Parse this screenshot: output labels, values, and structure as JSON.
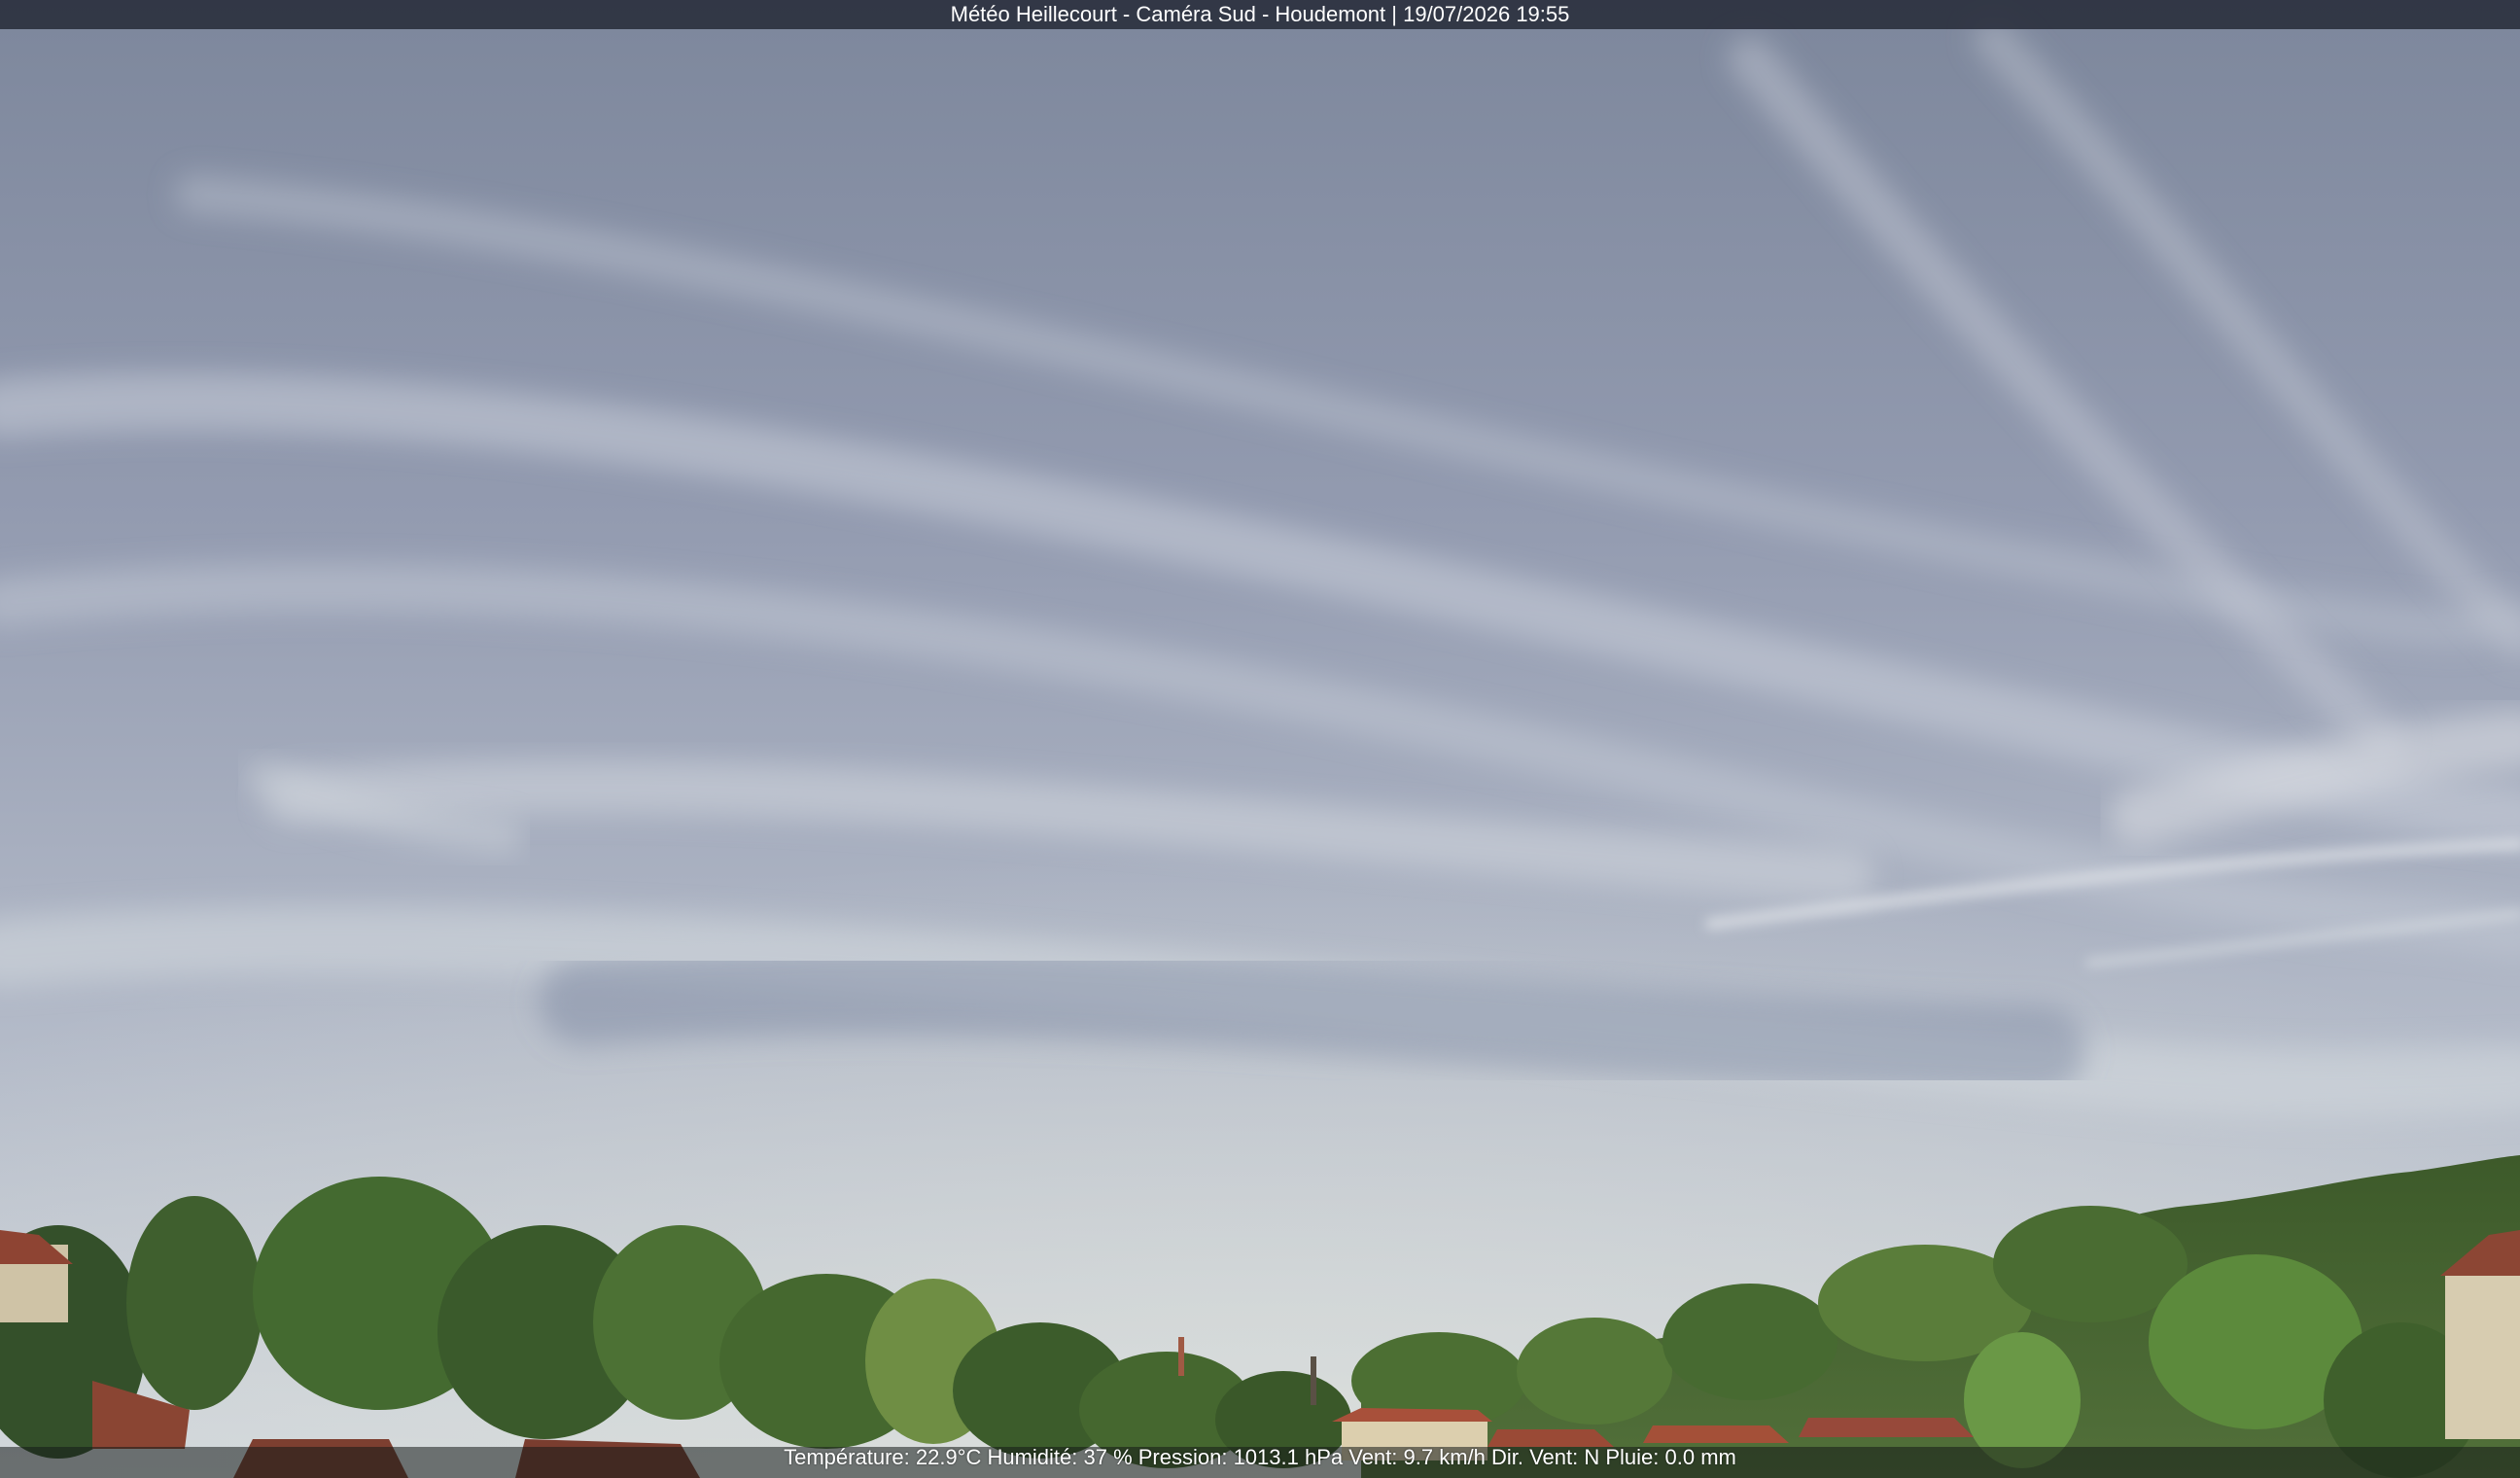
{
  "overlay": {
    "title": "Météo Heillecourt - Caméra Sud - Houdemont | 19/07/2026 19:55",
    "readout": "Température: 22.9°C  Humidité: 37 % Pression: 1013.1 hPa Vent: 9.7 km/h Dir. Vent: N Pluie: 0.0 mm"
  },
  "scene": {
    "sky_top": "#7f889e",
    "sky_mid": "#a6aec0",
    "sky_horizon": "#cdd4dc",
    "foliage_dark": "#2f4a22",
    "foliage_light": "#6f8a3c",
    "roof": "#9a4b36",
    "wall": "#d9cfb2"
  }
}
